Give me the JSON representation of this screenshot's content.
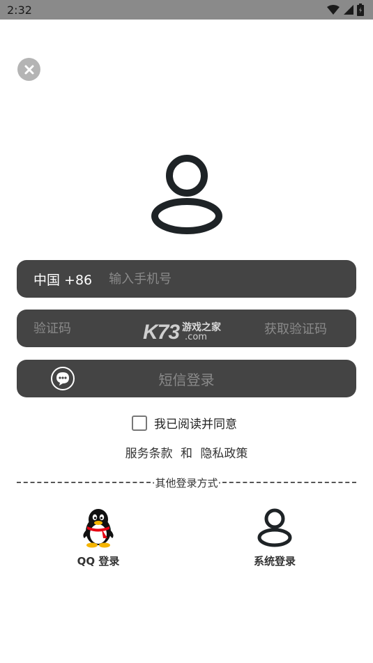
{
  "status_bar": {
    "time": "2:32"
  },
  "phone_field": {
    "country_code": "中国 +86",
    "placeholder": "输入手机号"
  },
  "code_field": {
    "placeholder": "验证码",
    "get_code_label": "获取验证码"
  },
  "watermark": {
    "brand": "K73",
    "site_cn": "游戏之家",
    "site_domain": ".com"
  },
  "sms_login": {
    "label": "短信登录"
  },
  "agreement": {
    "text": "我已阅读并同意",
    "terms": "服务条款",
    "conjunction": "和",
    "privacy": "隐私政策"
  },
  "divider": {
    "label": "·其他登录方式·"
  },
  "alt_logins": {
    "qq_label": "QQ 登录",
    "system_label": "系统登录"
  },
  "colors": {
    "field_bg": "#444444",
    "status_bar_bg": "#8a8a8a",
    "close_bg": "#b4b4b4",
    "qq_red": "#e60012",
    "qq_yellow": "#f5b400"
  },
  "icons": [
    "close-icon",
    "user-icon",
    "message-icon",
    "qq-penguin-icon",
    "wifi-icon",
    "signal-icon",
    "battery-icon"
  ]
}
